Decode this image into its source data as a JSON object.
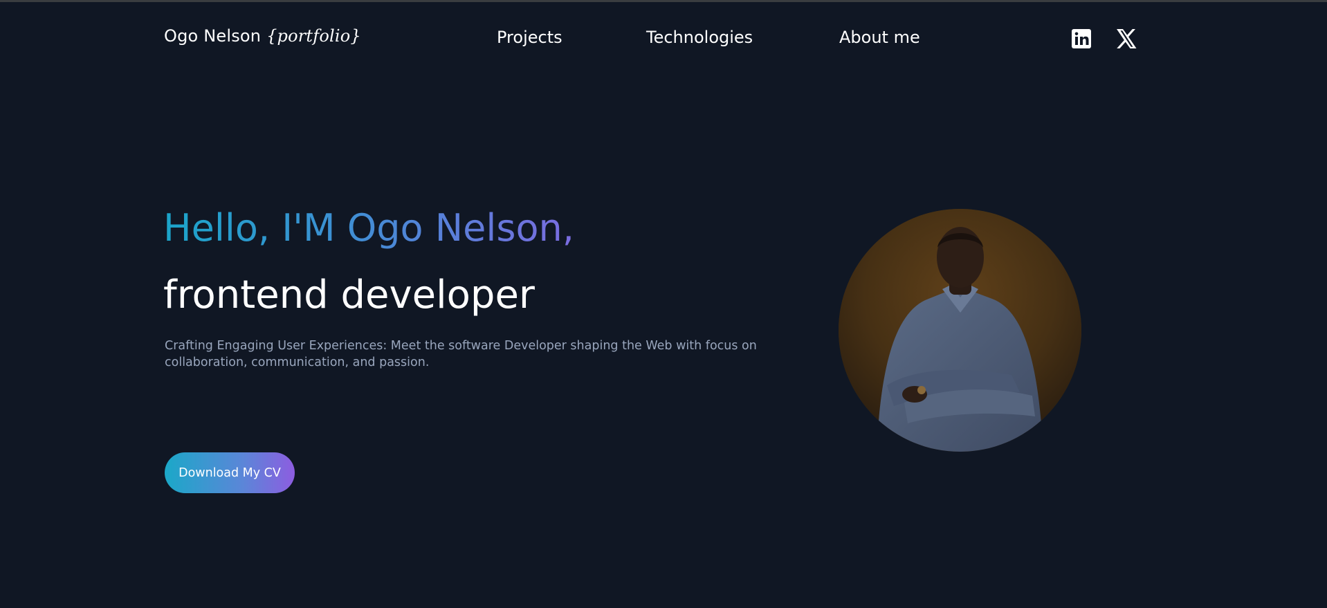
{
  "header": {
    "logo_name": "Ogo Nelson",
    "logo_suffix": "{portfolio}",
    "nav": {
      "projects": "Projects",
      "technologies": "Technologies",
      "about": "About me"
    },
    "social": {
      "linkedin_icon": "linkedin-icon",
      "x_icon": "x-twitter-icon"
    }
  },
  "hero": {
    "greeting": "Hello, I'M Ogo Nelson,",
    "role": "frontend developer",
    "description": "Crafting Engaging User Experiences: Meet the software Developer shaping the Web with focus on collaboration, communication, and passion.",
    "cv_button": "Download My CV",
    "portrait_alt": "portrait-photo"
  },
  "colors": {
    "background": "#101724",
    "gradient_start": "#1ba4c9",
    "gradient_end": "#8d5de0",
    "muted_text": "#99a6bd"
  }
}
